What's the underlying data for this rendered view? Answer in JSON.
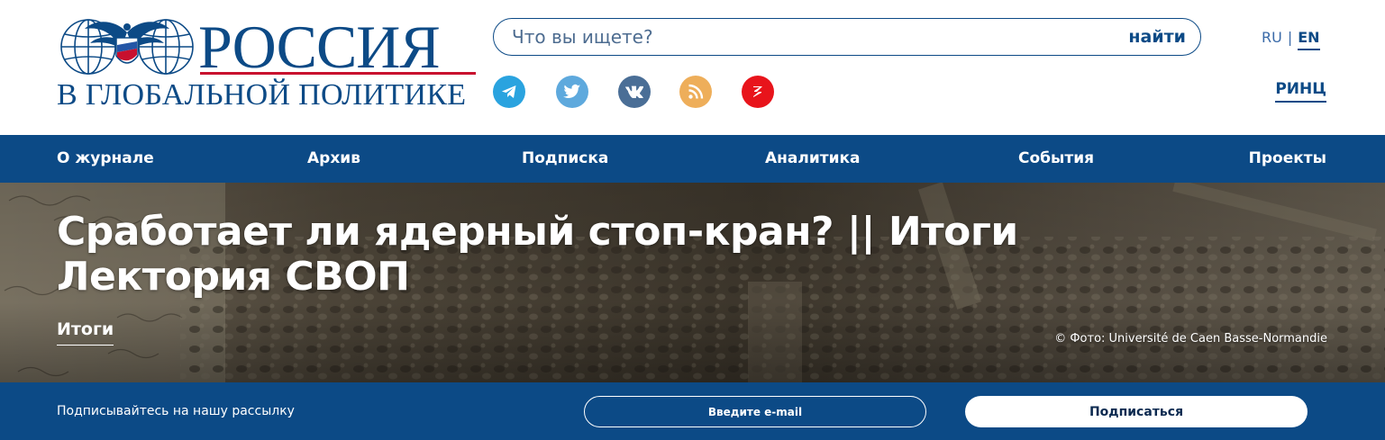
{
  "header": {
    "logo": {
      "title": "РОССИЯ",
      "subtitle": "В ГЛОБАЛЬНОЙ ПОЛИТИКЕ"
    },
    "search": {
      "placeholder": "Что вы ищете?",
      "button_label": "найти"
    },
    "socials": [
      {
        "icon": "telegram-icon",
        "color": "#2aa3df"
      },
      {
        "icon": "twitter-icon",
        "color": "#5ea9dd"
      },
      {
        "icon": "vk-icon",
        "color": "#4a6e96"
      },
      {
        "icon": "rss-icon",
        "color": "#eeae5a"
      },
      {
        "icon": "zen-icon",
        "color": "#e8141b"
      }
    ],
    "language": {
      "ru": "RU",
      "separator": "|",
      "en": "EN",
      "active": "EN"
    },
    "rinc_label": "РИНЦ"
  },
  "nav": {
    "items": [
      {
        "label": "О журнале"
      },
      {
        "label": "Архив"
      },
      {
        "label": "Подписка"
      },
      {
        "label": "Аналитика"
      },
      {
        "label": "События"
      },
      {
        "label": "Проекты"
      }
    ]
  },
  "hero": {
    "title": "Сработает ли ядерный стоп-кран? || Итоги Лектория СВОП",
    "tag": "Итоги",
    "photo_credit": "© Фото: Université de Caen Basse-Normandie"
  },
  "newsletter": {
    "label": "Подписывайтесь на нашу рассылку",
    "email_placeholder": "Введите e-mail",
    "button_label": "Подписаться"
  },
  "colors": {
    "brand_blue": "#0c4a86",
    "accent_red": "#c8102e",
    "white": "#ffffff"
  }
}
